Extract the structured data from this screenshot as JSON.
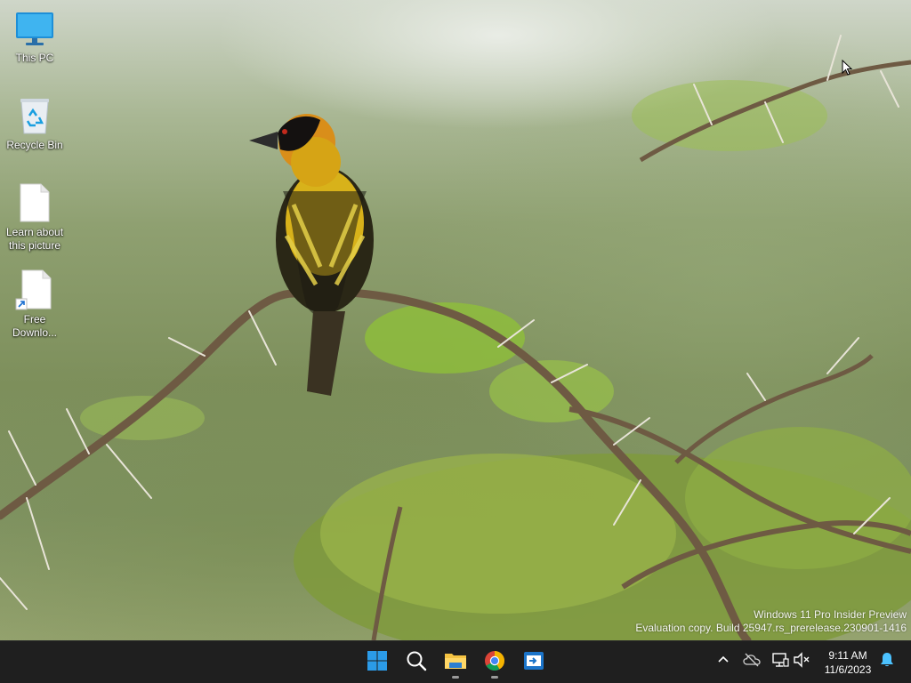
{
  "desktop": {
    "icons": [
      {
        "label": "This PC",
        "icon": "monitor-icon"
      },
      {
        "label": "Recycle Bin",
        "icon": "recycle-bin-icon"
      },
      {
        "label": "Learn about\nthis picture",
        "icon": "document-icon"
      },
      {
        "label": "Free\nDownlo...",
        "icon": "shortcut-document-icon"
      }
    ],
    "watermark": {
      "line1": "Windows 11 Pro Insider Preview",
      "line2": "Evaluation copy. Build 25947.rs_prerelease.230901-1416"
    }
  },
  "taskbar": {
    "apps": [
      {
        "name": "Start",
        "icon": "windows-start-icon"
      },
      {
        "name": "Search",
        "icon": "search-icon"
      },
      {
        "name": "File Explorer",
        "icon": "folder-icon",
        "running": true
      },
      {
        "name": "Google Chrome",
        "icon": "chrome-icon",
        "running": true
      },
      {
        "name": "Remote Desktop",
        "icon": "remote-desktop-icon"
      }
    ],
    "tray": {
      "time": "9:11 AM",
      "date": "11/6/2023"
    }
  },
  "colors": {
    "taskbar_bg": "#1f1f1f",
    "start_blue": "#2b9be8",
    "folder_yellow": "#f5c342",
    "notification_blue": "#4cc2ff"
  }
}
